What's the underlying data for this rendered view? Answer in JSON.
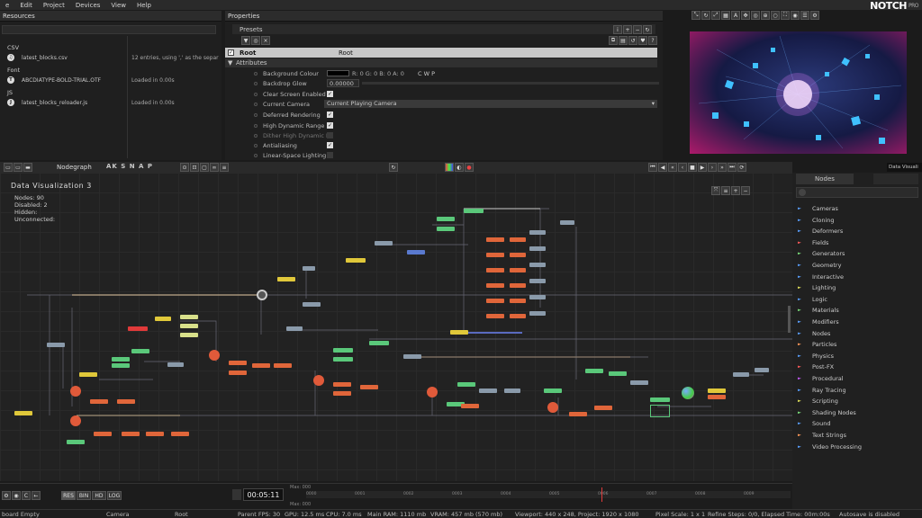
{
  "menu": [
    "e",
    "Edit",
    "Project",
    "Devices",
    "View",
    "Help"
  ],
  "logo": {
    "name": "NOTCH",
    "edition": "PRO"
  },
  "resources": {
    "title": "Resources",
    "categories": [
      {
        "name": "CSV",
        "items": [
          {
            "name": "latest_blocks.csv",
            "icon": "music-note-icon",
            "desc": "12 entries, using ',' as the separ"
          }
        ]
      },
      {
        "name": "Font",
        "items": [
          {
            "name": "ABCDIATYPE-BOLD-TRIAL.OTF",
            "icon": "font-icon",
            "desc": "Loaded in 0.00s"
          }
        ]
      },
      {
        "name": "JS",
        "items": [
          {
            "name": "latest_blocks_reloader.js",
            "icon": "script-icon",
            "desc": "Loaded in 0.00s"
          }
        ]
      }
    ]
  },
  "properties": {
    "title": "Properties",
    "presets": "Presets",
    "root": {
      "label": "Root",
      "value": "Root"
    },
    "attributes_header": "Attributes",
    "rows": [
      {
        "label": "Background Colour",
        "value": "R: 0 G: 0 B: 0 A: 0",
        "extra": "C   W   P",
        "type": "color"
      },
      {
        "label": "Backdrop Glow",
        "value": "0.00000",
        "type": "number"
      },
      {
        "label": "Clear Screen Enabled",
        "type": "check",
        "checked": true
      },
      {
        "label": "Current Camera",
        "value": "Current Playing Camera",
        "type": "select"
      },
      {
        "label": "Deferred Rendering",
        "type": "check",
        "checked": true
      },
      {
        "label": "High Dynamic Range",
        "type": "check",
        "checked": true
      },
      {
        "label": "Dither High Dynamic Ra",
        "type": "check",
        "checked": false
      },
      {
        "label": "Antialiasing",
        "type": "check",
        "checked": true
      },
      {
        "label": "Linear-Space Lighting",
        "type": "check",
        "checked": false
      }
    ]
  },
  "nodegraph": {
    "title": "Nodegraph",
    "toolbar_letters": "AK S N A P",
    "layer_title": "Data  Visualization  3",
    "stats": [
      "Nodes:  90",
      "Disabled:  2",
      "Hidden:",
      "Unconnected:"
    ]
  },
  "nodes_browser": {
    "tab": "Nodes",
    "items": [
      {
        "name": "Cameras",
        "color": "#5aa0ff"
      },
      {
        "name": "Cloning",
        "color": "#5aa0ff"
      },
      {
        "name": "Deformers",
        "color": "#5aa0ff"
      },
      {
        "name": "Fields",
        "color": "#ff5a5a"
      },
      {
        "name": "Generators",
        "color": "#7adf7a"
      },
      {
        "name": "Geometry",
        "color": "#5aa0ff"
      },
      {
        "name": "Interactive",
        "color": "#5aa0ff"
      },
      {
        "name": "Lighting",
        "color": "#e0e05a"
      },
      {
        "name": "Logic",
        "color": "#5aa0ff"
      },
      {
        "name": "Materials",
        "color": "#7adf7a"
      },
      {
        "name": "Modifiers",
        "color": "#5aa0ff"
      },
      {
        "name": "Nodes",
        "color": "#5aa0ff"
      },
      {
        "name": "Particles",
        "color": "#ff9a5a"
      },
      {
        "name": "Physics",
        "color": "#5aa0ff"
      },
      {
        "name": "Post-FX",
        "color": "#ff5a5a"
      },
      {
        "name": "Procedural",
        "color": "#c85aff"
      },
      {
        "name": "Ray Tracing",
        "color": "#5aa0ff"
      },
      {
        "name": "Scripting",
        "color": "#e0e05a"
      },
      {
        "name": "Shading Nodes",
        "color": "#7adf7a"
      },
      {
        "name": "Sound",
        "color": "#5aa0ff"
      },
      {
        "name": "Text Strings",
        "color": "#ff9a5a"
      },
      {
        "name": "Video Processing",
        "color": "#5aa0ff"
      }
    ]
  },
  "timeline": {
    "buttons": [
      "RES",
      "BIN",
      "HD",
      "LOG"
    ],
    "time": "00:05:11",
    "max_top": "Max: 000",
    "max_bottom": "Max: 000",
    "ticks": [
      "0000",
      "0001",
      "0002",
      "0003",
      "0004",
      "0005",
      "0006",
      "0007",
      "0008",
      "0009"
    ]
  },
  "viewer": {
    "label": "Data Visuali"
  },
  "status": {
    "items": [
      "board Empty",
      "Camera",
      "Root",
      "Parent  FPS: 30",
      "GPU: 12.5 ms",
      "CPU: 7.0 ms",
      "Main RAM: 1110 mb",
      "VRAM: 457 mb (570 mb)",
      "Viewport: 440 x 248, Project: 1920 x 1080",
      "Pixel Scale: 1 x 1",
      "Refine Steps: 0/0, Elapsed Time: 00m:00s",
      "Autosave is disabled"
    ]
  }
}
